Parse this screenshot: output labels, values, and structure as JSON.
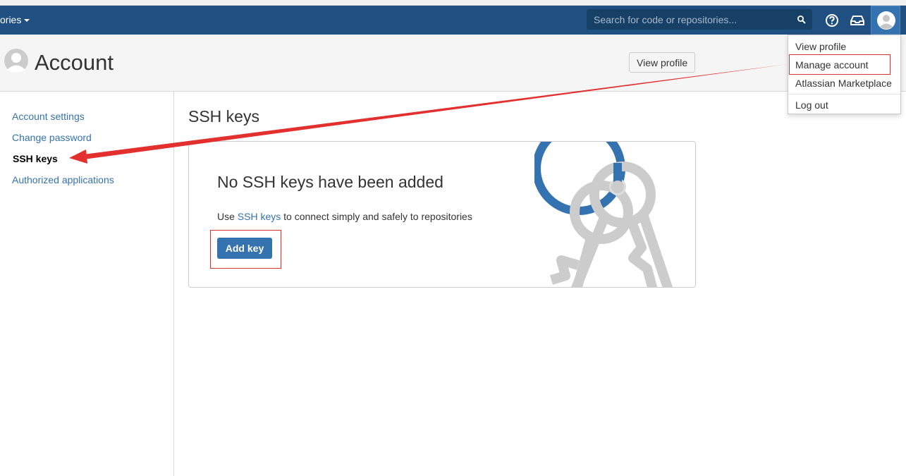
{
  "navbar": {
    "repositories_label": "ories",
    "search_placeholder": "Search for code or repositories..."
  },
  "header": {
    "title": "Account",
    "view_profile_label": "View profile"
  },
  "user_menu": {
    "items": [
      {
        "label": "View profile"
      },
      {
        "label": "Manage account"
      },
      {
        "label": "Atlassian Marketplace"
      },
      {
        "label": "Log out"
      }
    ]
  },
  "sidebar": {
    "items": [
      {
        "label": "Account settings",
        "active": false
      },
      {
        "label": "Change password",
        "active": false
      },
      {
        "label": "SSH keys",
        "active": true
      },
      {
        "label": "Authorized applications",
        "active": false
      }
    ]
  },
  "main": {
    "section_title": "SSH keys",
    "empty_state": {
      "title": "No SSH keys have been added",
      "desc_prefix": "Use ",
      "desc_link": "SSH keys",
      "desc_suffix": " to connect simply and safely to repositories",
      "button_label": "Add key"
    }
  },
  "colors": {
    "navbar": "#205081",
    "link": "#3572b0",
    "primary_button": "#3572b0",
    "annotation": "#e3302f"
  }
}
